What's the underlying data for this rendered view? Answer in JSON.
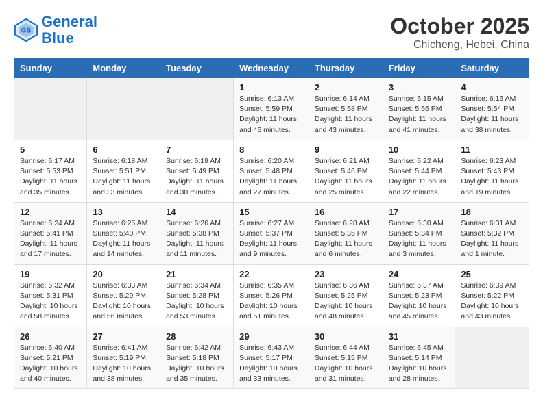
{
  "header": {
    "logo_line1": "General",
    "logo_line2": "Blue",
    "title": "October 2025",
    "subtitle": "Chicheng, Hebei, China"
  },
  "weekdays": [
    "Sunday",
    "Monday",
    "Tuesday",
    "Wednesday",
    "Thursday",
    "Friday",
    "Saturday"
  ],
  "weeks": [
    [
      {
        "day": "",
        "info": ""
      },
      {
        "day": "",
        "info": ""
      },
      {
        "day": "",
        "info": ""
      },
      {
        "day": "1",
        "info": "Sunrise: 6:13 AM\nSunset: 5:59 PM\nDaylight: 11 hours and 46 minutes."
      },
      {
        "day": "2",
        "info": "Sunrise: 6:14 AM\nSunset: 5:58 PM\nDaylight: 11 hours and 43 minutes."
      },
      {
        "day": "3",
        "info": "Sunrise: 6:15 AM\nSunset: 5:56 PM\nDaylight: 11 hours and 41 minutes."
      },
      {
        "day": "4",
        "info": "Sunrise: 6:16 AM\nSunset: 5:54 PM\nDaylight: 11 hours and 38 minutes."
      }
    ],
    [
      {
        "day": "5",
        "info": "Sunrise: 6:17 AM\nSunset: 5:53 PM\nDaylight: 11 hours and 35 minutes."
      },
      {
        "day": "6",
        "info": "Sunrise: 6:18 AM\nSunset: 5:51 PM\nDaylight: 11 hours and 33 minutes."
      },
      {
        "day": "7",
        "info": "Sunrise: 6:19 AM\nSunset: 5:49 PM\nDaylight: 11 hours and 30 minutes."
      },
      {
        "day": "8",
        "info": "Sunrise: 6:20 AM\nSunset: 5:48 PM\nDaylight: 11 hours and 27 minutes."
      },
      {
        "day": "9",
        "info": "Sunrise: 6:21 AM\nSunset: 5:46 PM\nDaylight: 11 hours and 25 minutes."
      },
      {
        "day": "10",
        "info": "Sunrise: 6:22 AM\nSunset: 5:44 PM\nDaylight: 11 hours and 22 minutes."
      },
      {
        "day": "11",
        "info": "Sunrise: 6:23 AM\nSunset: 5:43 PM\nDaylight: 11 hours and 19 minutes."
      }
    ],
    [
      {
        "day": "12",
        "info": "Sunrise: 6:24 AM\nSunset: 5:41 PM\nDaylight: 11 hours and 17 minutes."
      },
      {
        "day": "13",
        "info": "Sunrise: 6:25 AM\nSunset: 5:40 PM\nDaylight: 11 hours and 14 minutes."
      },
      {
        "day": "14",
        "info": "Sunrise: 6:26 AM\nSunset: 5:38 PM\nDaylight: 11 hours and 11 minutes."
      },
      {
        "day": "15",
        "info": "Sunrise: 6:27 AM\nSunset: 5:37 PM\nDaylight: 11 hours and 9 minutes."
      },
      {
        "day": "16",
        "info": "Sunrise: 6:28 AM\nSunset: 5:35 PM\nDaylight: 11 hours and 6 minutes."
      },
      {
        "day": "17",
        "info": "Sunrise: 6:30 AM\nSunset: 5:34 PM\nDaylight: 11 hours and 3 minutes."
      },
      {
        "day": "18",
        "info": "Sunrise: 6:31 AM\nSunset: 5:32 PM\nDaylight: 11 hours and 1 minute."
      }
    ],
    [
      {
        "day": "19",
        "info": "Sunrise: 6:32 AM\nSunset: 5:31 PM\nDaylight: 10 hours and 58 minutes."
      },
      {
        "day": "20",
        "info": "Sunrise: 6:33 AM\nSunset: 5:29 PM\nDaylight: 10 hours and 56 minutes."
      },
      {
        "day": "21",
        "info": "Sunrise: 6:34 AM\nSunset: 5:28 PM\nDaylight: 10 hours and 53 minutes."
      },
      {
        "day": "22",
        "info": "Sunrise: 6:35 AM\nSunset: 5:26 PM\nDaylight: 10 hours and 51 minutes."
      },
      {
        "day": "23",
        "info": "Sunrise: 6:36 AM\nSunset: 5:25 PM\nDaylight: 10 hours and 48 minutes."
      },
      {
        "day": "24",
        "info": "Sunrise: 6:37 AM\nSunset: 5:23 PM\nDaylight: 10 hours and 45 minutes."
      },
      {
        "day": "25",
        "info": "Sunrise: 6:39 AM\nSunset: 5:22 PM\nDaylight: 10 hours and 43 minutes."
      }
    ],
    [
      {
        "day": "26",
        "info": "Sunrise: 6:40 AM\nSunset: 5:21 PM\nDaylight: 10 hours and 40 minutes."
      },
      {
        "day": "27",
        "info": "Sunrise: 6:41 AM\nSunset: 5:19 PM\nDaylight: 10 hours and 38 minutes."
      },
      {
        "day": "28",
        "info": "Sunrise: 6:42 AM\nSunset: 5:18 PM\nDaylight: 10 hours and 35 minutes."
      },
      {
        "day": "29",
        "info": "Sunrise: 6:43 AM\nSunset: 5:17 PM\nDaylight: 10 hours and 33 minutes."
      },
      {
        "day": "30",
        "info": "Sunrise: 6:44 AM\nSunset: 5:15 PM\nDaylight: 10 hours and 31 minutes."
      },
      {
        "day": "31",
        "info": "Sunrise: 6:45 AM\nSunset: 5:14 PM\nDaylight: 10 hours and 28 minutes."
      },
      {
        "day": "",
        "info": ""
      }
    ]
  ]
}
